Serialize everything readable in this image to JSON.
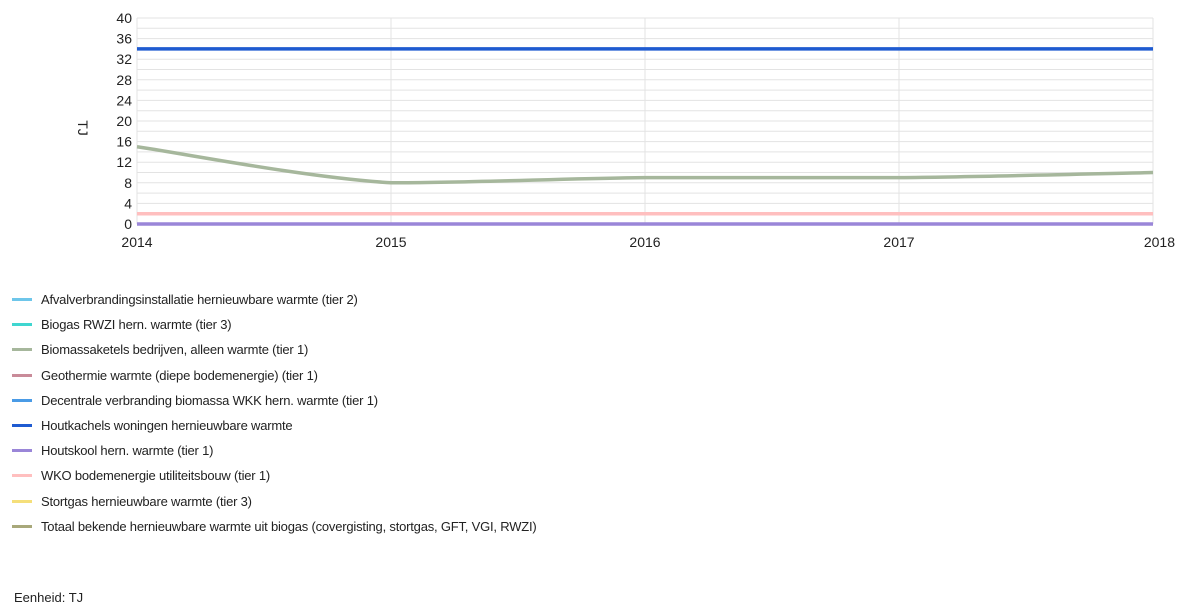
{
  "chart_data": {
    "type": "line",
    "x": [
      2014,
      2015,
      2016,
      2017,
      2018
    ],
    "x_tick_labels": [
      "2014",
      "2015",
      "2016",
      "2017",
      "2018"
    ],
    "ylabel": "TJ",
    "ylim": [
      0,
      40
    ],
    "y_ticks": [
      0,
      4,
      8,
      12,
      16,
      20,
      24,
      28,
      32,
      36,
      40
    ],
    "grid": true,
    "legend_position": "bottom",
    "series": [
      {
        "name": "Afvalverbrandingsinstallatie hernieuwbare warmte (tier 2)",
        "color": "#6ec6ea",
        "values": [
          null,
          null,
          null,
          null,
          null
        ]
      },
      {
        "name": "Biogas RWZI hern. warmte (tier 3)",
        "color": "#3fd6d0",
        "values": [
          null,
          null,
          null,
          null,
          null
        ]
      },
      {
        "name": "Biomassaketels bedrijven, alleen warmte (tier 1)",
        "color": "#a6b79c",
        "values": [
          15,
          8,
          9,
          9,
          10
        ]
      },
      {
        "name": "Geothermie warmte (diepe bodemenergie) (tier 1)",
        "color": "#c98b99",
        "values": [
          null,
          null,
          null,
          null,
          null
        ]
      },
      {
        "name": "Decentrale verbranding biomassa WKK hern. warmte (tier 1)",
        "color": "#4a9be6",
        "values": [
          null,
          null,
          null,
          null,
          null
        ]
      },
      {
        "name": "Houtkachels woningen hernieuwbare warmte",
        "color": "#1f5bd1",
        "values": [
          34,
          34,
          34,
          34,
          34
        ]
      },
      {
        "name": "Houtskool hern. warmte (tier 1)",
        "color": "#9a86d8",
        "values": [
          0,
          0,
          0,
          0,
          0
        ]
      },
      {
        "name": "WKO bodemenergie utiliteitsbouw (tier 1)",
        "color": "#ffbfbf",
        "values": [
          2,
          2,
          2,
          2,
          2
        ]
      },
      {
        "name": "Stortgas hernieuwbare warmte (tier 3)",
        "color": "#f5df7a",
        "values": [
          null,
          null,
          null,
          null,
          null
        ]
      },
      {
        "name": "Totaal bekende hernieuwbare warmte uit biogas (covergisting, stortgas, GFT, VGI, RWZI)",
        "color": "#a8a87a",
        "values": [
          null,
          null,
          null,
          null,
          null
        ]
      }
    ]
  },
  "unit_text": "Eenheid: TJ"
}
